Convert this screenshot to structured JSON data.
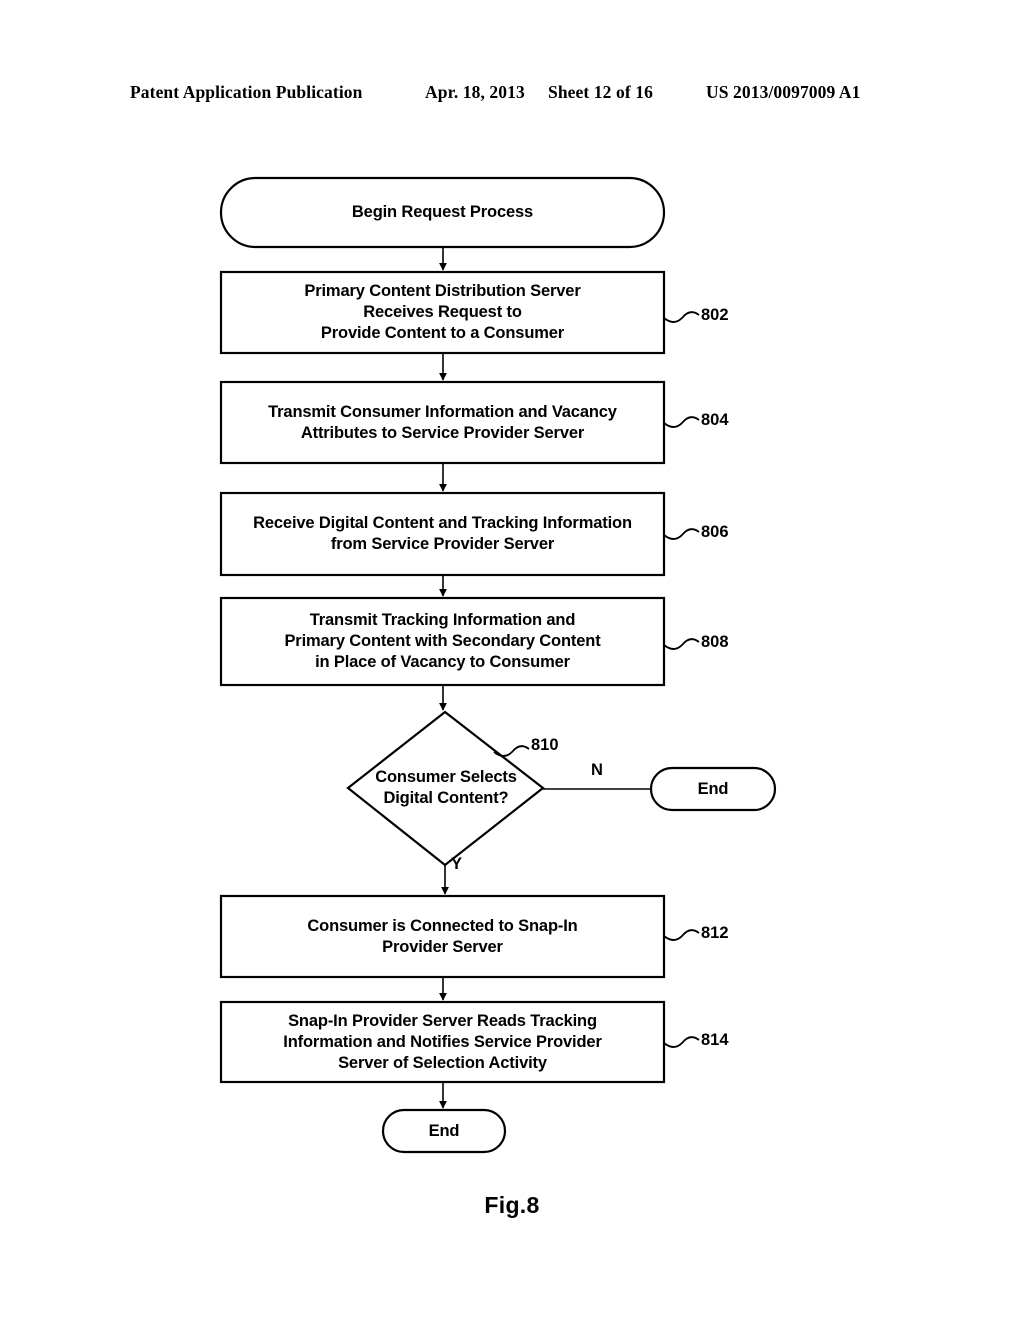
{
  "header": {
    "left": "Patent Application Publication",
    "date": "Apr. 18, 2013",
    "sheet": "Sheet 12 of 16",
    "publication_number": "US 2013/0097009 A1"
  },
  "figure": {
    "caption": "Fig.8"
  },
  "flowchart": {
    "nodes": [
      {
        "id": "begin",
        "shape": "terminator",
        "text": "Begin Request Process",
        "ref": ""
      },
      {
        "id": "n802",
        "shape": "process",
        "text": "Primary Content Distribution Server\nReceives Request to\nProvide Content to a Consumer",
        "ref": "802"
      },
      {
        "id": "n804",
        "shape": "process",
        "text": "Transmit Consumer Information and Vacancy\nAttributes to Service Provider Server",
        "ref": "804"
      },
      {
        "id": "n806",
        "shape": "process",
        "text": "Receive Digital Content and Tracking Information\nfrom Service Provider Server",
        "ref": "806"
      },
      {
        "id": "n808",
        "shape": "process",
        "text": "Transmit Tracking Information and\nPrimary Content with Secondary Content\nin Place of Vacancy to Consumer",
        "ref": "808"
      },
      {
        "id": "n810",
        "shape": "decision",
        "text": "Consumer Selects\nDigital Content?",
        "ref": "810"
      },
      {
        "id": "end_n",
        "shape": "terminator",
        "text": "End",
        "ref": ""
      },
      {
        "id": "n812",
        "shape": "process",
        "text": "Consumer is Connected to Snap-In\nProvider Server",
        "ref": "812"
      },
      {
        "id": "n814",
        "shape": "process",
        "text": "Snap-In Provider Server Reads Tracking\nInformation and Notifies Service Provider\nServer of Selection Activity",
        "ref": "814"
      },
      {
        "id": "end_y",
        "shape": "terminator",
        "text": "End",
        "ref": ""
      }
    ],
    "branch_labels": {
      "no": "N",
      "yes": "Y"
    },
    "line_color": "#000000",
    "fill_color": "#ffffff"
  }
}
